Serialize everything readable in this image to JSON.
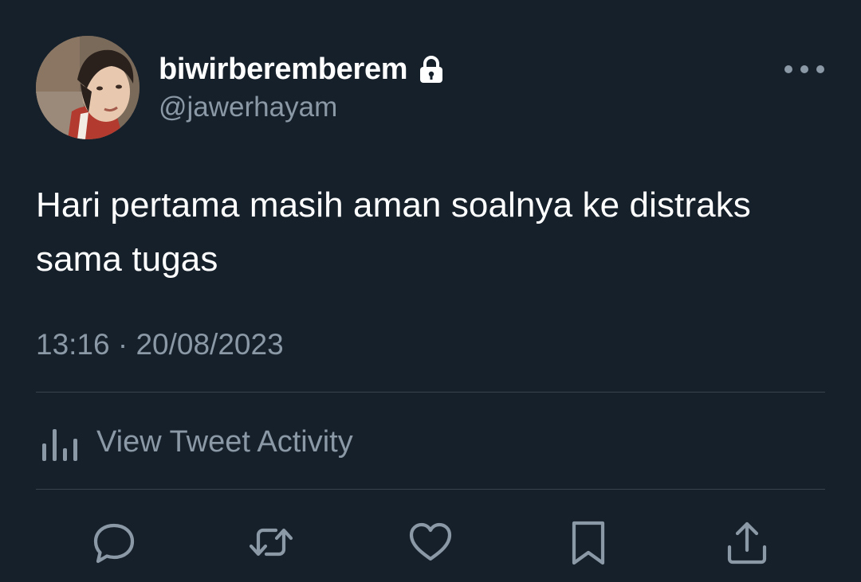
{
  "tweet": {
    "author": {
      "display_name": "biwirberemberem",
      "handle": "@jawerhayam",
      "protected_icon": "lock-icon",
      "avatar": "user-avatar-photo"
    },
    "text": "Hari pertama masih aman soalnya ke distraks sama tugas",
    "timestamp": "13:16 · 20/08/2023",
    "activity_label": "View Tweet Activity",
    "activity_icon": "bar-chart-icon",
    "more_icon": "more-options-icon",
    "actions": [
      {
        "name": "reply",
        "icon": "reply-icon"
      },
      {
        "name": "retweet",
        "icon": "retweet-icon"
      },
      {
        "name": "like",
        "icon": "heart-icon"
      },
      {
        "name": "bookmark",
        "icon": "bookmark-icon"
      },
      {
        "name": "share",
        "icon": "share-icon"
      }
    ]
  },
  "colors": {
    "background": "#15202b",
    "primary_text": "#ffffff",
    "secondary_text": "#8b98a5",
    "divider": "#38444d"
  }
}
